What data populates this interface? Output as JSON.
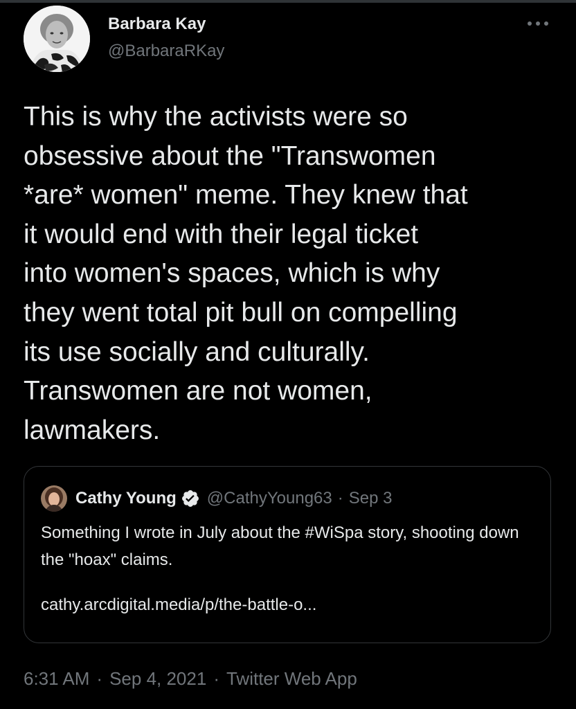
{
  "tweet": {
    "author": {
      "name": "Barbara Kay",
      "handle": "@BarbaraRKay"
    },
    "text": "This is why the activists were so\nobsessive about the \"Transwomen\n*are* women\" meme. They knew that\nit would end with their legal ticket\ninto women's spaces, which is why\nthey went total pit bull on compelling\nits use socially and culturally.\nTranswomen are not women,\nlawmakers.",
    "quoted": {
      "name": "Cathy Young",
      "verified": true,
      "handle": "@CathyYoung63",
      "separator": "·",
      "date": "Sep 3",
      "text": "Something I wrote in July about the #WiSpa story, shooting down the \"hoax\" claims.",
      "link": "cathy.arcdigital.media/p/the-battle-o..."
    },
    "meta": {
      "time": "6:31 AM",
      "separator": "·",
      "date": "Sep 4, 2021",
      "app": "Twitter Web App"
    }
  },
  "colors": {
    "background": "#000000",
    "text": "#e7e9ea",
    "secondary": "#71767b",
    "border": "#333639",
    "verified": "#e7e9ea"
  },
  "icons": {
    "more": "more-horizontal-icon",
    "verified": "verified-badge-icon"
  }
}
